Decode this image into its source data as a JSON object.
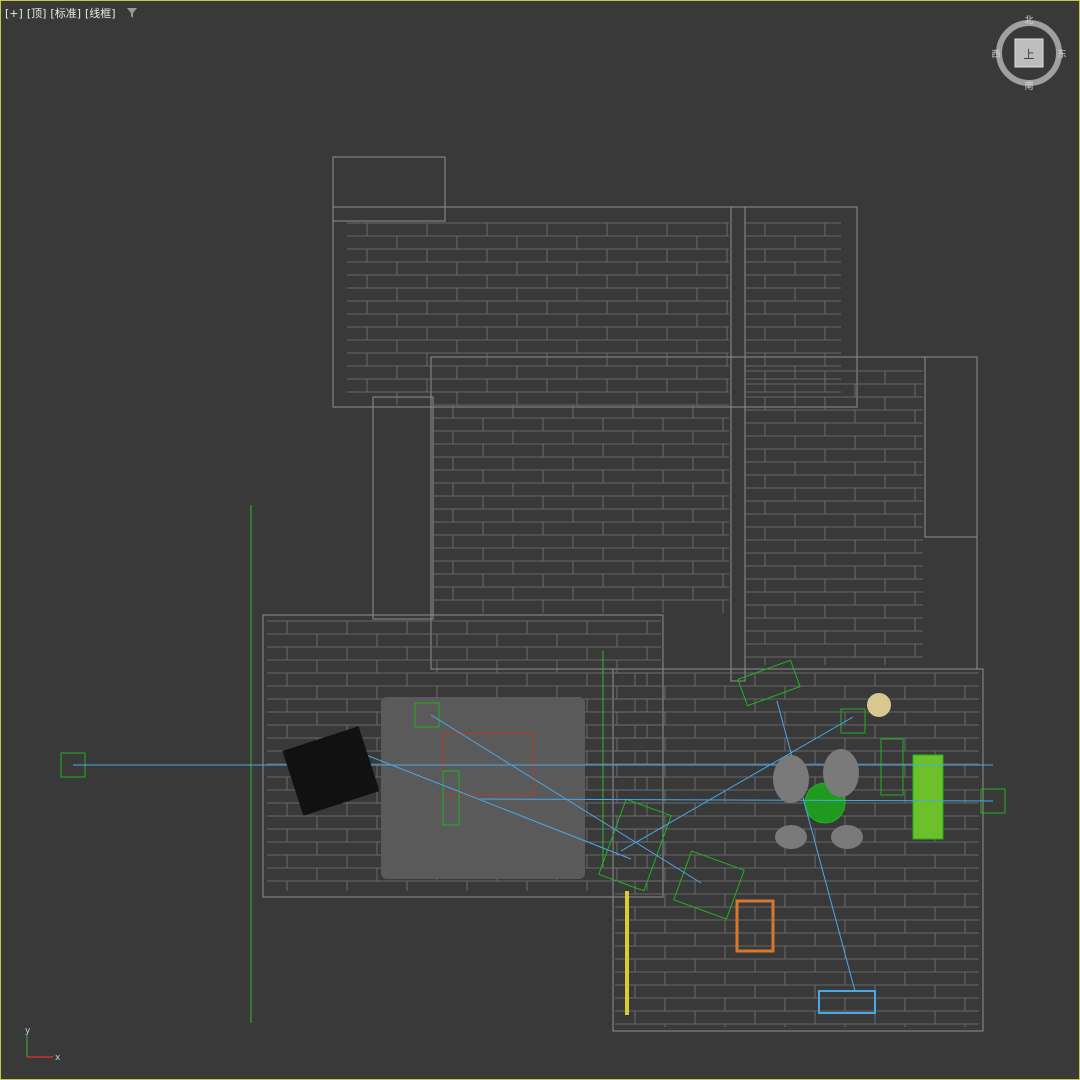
{
  "viewport": {
    "menu": {
      "plus": "[+]",
      "view": "[顶]",
      "shading_mode": "[标准]",
      "display_mode": "[线框]"
    },
    "filter_icon": "funnel-icon",
    "viewcube": {
      "face": "上",
      "north": "北",
      "south": "南",
      "east": "东",
      "west": "西"
    },
    "axis_gizmo": {
      "y_axis": "y",
      "x_axis": "x"
    }
  },
  "colors": {
    "viewport_bg": "#393939",
    "active_border": "#c8c83c",
    "wire_gray": "#8e8e8e",
    "selected_green": "#1fb31f",
    "light_target_blue": "#4aa8e8",
    "furniture_orange": "#d8782a",
    "rug_gray": "#5a5a5a"
  }
}
